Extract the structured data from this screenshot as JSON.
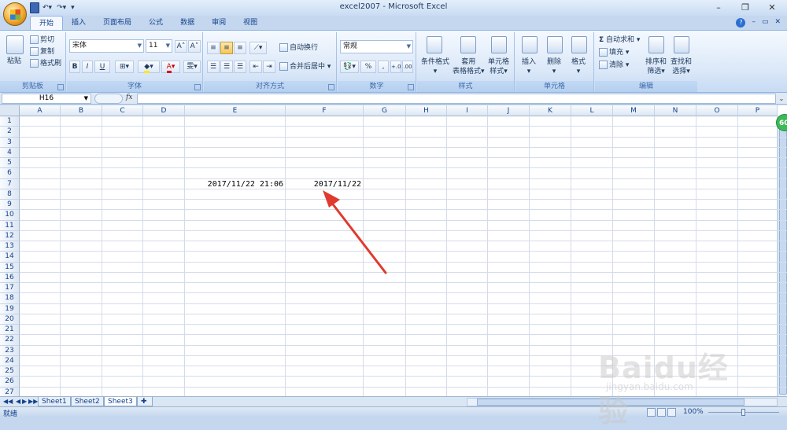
{
  "window": {
    "title": "excel2007 - Microsoft Excel",
    "controls": [
      "minimize",
      "restore",
      "close"
    ]
  },
  "quick_access": {
    "save_icon": "save-icon",
    "undo_icon": "undo-icon",
    "redo_icon": "redo-icon"
  },
  "tabs": [
    "开始",
    "插入",
    "页面布局",
    "公式",
    "数据",
    "审阅",
    "视图"
  ],
  "active_tab": "开始",
  "ribbon": {
    "clipboard": {
      "paste": "粘贴",
      "cut": "剪切",
      "copy": "复制",
      "format_painter": "格式刷",
      "label": "剪贴板"
    },
    "font": {
      "name": "宋体",
      "size": "11",
      "bold": "B",
      "italic": "I",
      "underline": "U",
      "label": "字体"
    },
    "alignment": {
      "wrap": "自动换行",
      "merge": "合并后居中",
      "label": "对齐方式"
    },
    "number": {
      "format": "常规",
      "percent": "%",
      "comma": ",",
      "label": "数字"
    },
    "styles": {
      "conditional": "条件格式",
      "table1": "套用",
      "table2": "表格格式",
      "cell1": "单元格",
      "cell2": "样式",
      "label": "样式"
    },
    "cells": {
      "insert": "插入",
      "delete": "删除",
      "format": "格式",
      "label": "单元格"
    },
    "editing": {
      "autosum": "自动求和",
      "fill": "填充",
      "clear": "清除",
      "sort1": "排序和",
      "sort2": "筛选",
      "find1": "查找和",
      "find2": "选择",
      "label": "编辑"
    }
  },
  "formula_bar": {
    "name_box": "H16",
    "fx": "fx",
    "value": ""
  },
  "columns": [
    "A",
    "B",
    "C",
    "D",
    "E",
    "F",
    "G",
    "H",
    "I",
    "J",
    "K",
    "L",
    "M",
    "N",
    "O",
    "P"
  ],
  "rows": [
    "1",
    "2",
    "3",
    "4",
    "5",
    "6",
    "7",
    "8",
    "9",
    "10",
    "11",
    "12",
    "13",
    "14",
    "15",
    "16",
    "17",
    "18",
    "19",
    "20",
    "21",
    "22",
    "23",
    "24",
    "25",
    "26",
    "27"
  ],
  "cells": {
    "E7": "2017/11/22 21:06",
    "F7": "2017/11/22"
  },
  "badge": "60",
  "sheets": [
    "Sheet1",
    "Sheet2",
    "Sheet3"
  ],
  "active_sheet": "Sheet3",
  "status": {
    "ready": "就绪",
    "zoom": "100%"
  },
  "watermark": {
    "brand": "Baidu经验",
    "url": "jingyan.baidu.com"
  },
  "accent": {
    "arrow": "#e03a2f",
    "ribbon": "#dbe8f8",
    "selected_button": "#f7c65a"
  }
}
